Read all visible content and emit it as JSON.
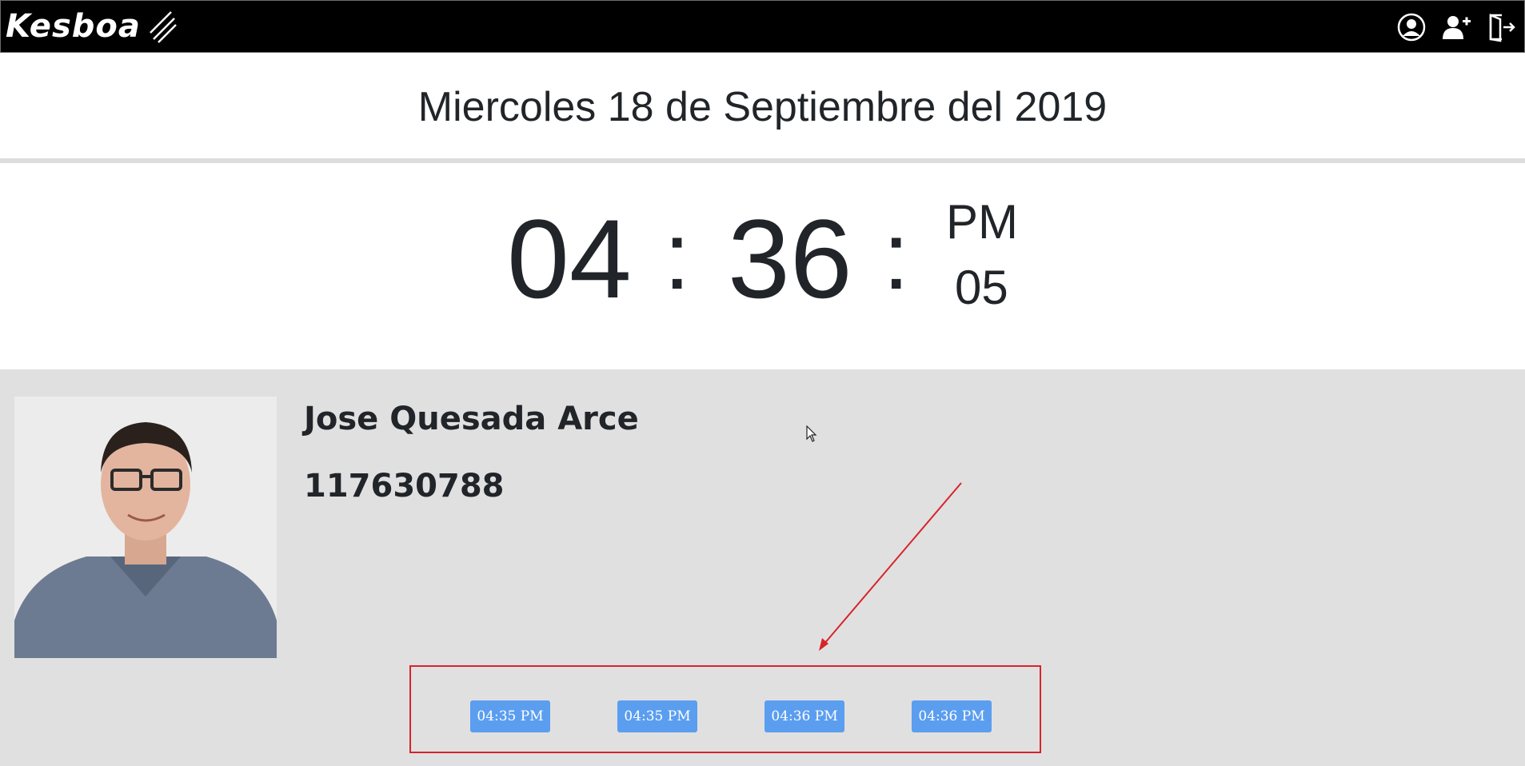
{
  "navbar": {
    "brand": "Kesboa",
    "icons": [
      "user-circle-icon",
      "user-add-icon",
      "sign-out-icon"
    ]
  },
  "date": "Miercoles 18 de Septiembre del 2019",
  "clock": {
    "hours": "04",
    "separator": ":",
    "minutes": "36",
    "ampm": "PM",
    "seconds": "05"
  },
  "employee": {
    "name": "Jose Quesada Arce",
    "id": "117630788"
  },
  "punches": [
    "04:35 PM",
    "04:35 PM",
    "04:36 PM",
    "04:36 PM"
  ],
  "colors": {
    "navbar": "#000000",
    "panel": "#e0e0e0",
    "punch_button": "#5b9ef0",
    "annotation": "#d8232a"
  }
}
